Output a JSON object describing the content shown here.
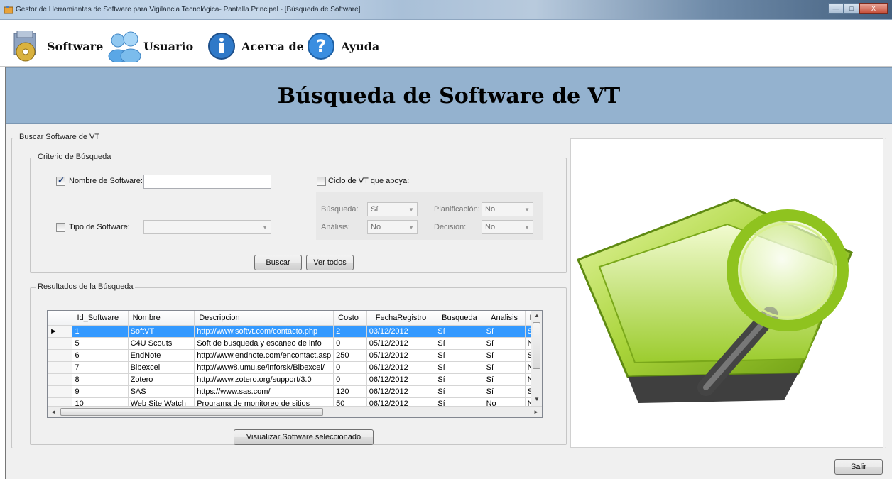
{
  "window": {
    "title": "Gestor de Herramientas de Software para Vigilancia Tecnológica- Pantalla Principal - [Búsqueda de Software]",
    "minimize_label": "—",
    "maximize_label": "□",
    "close_label": "X"
  },
  "menu": {
    "items": [
      {
        "label": "Software",
        "icon": "software-disc-icon"
      },
      {
        "label": "Usuario",
        "icon": "users-icon"
      },
      {
        "label": "Acerca de",
        "icon": "info-icon"
      },
      {
        "label": "Ayuda",
        "icon": "help-icon"
      }
    ]
  },
  "header": {
    "title": "Búsqueda de Software de VT"
  },
  "search_group": {
    "title": "Buscar Software de VT",
    "criteria": {
      "title": "Criterio de Búsqueda",
      "name_label": "Nombre de Software:",
      "name_checked": true,
      "name_value": "",
      "type_label": "Tipo de Software:",
      "type_checked": false,
      "type_value": "",
      "cycle_label": "Ciclo de VT que apoya:",
      "cycle_checked": false,
      "busqueda_label": "Búsqueda:",
      "busqueda_value": "Sí",
      "planificacion_label": "Planificación:",
      "planificacion_value": "No",
      "analisis_label": "Análisis:",
      "analisis_value": "No",
      "decision_label": "Decisión:",
      "decision_value": "No",
      "search_button": "Buscar",
      "show_all_button": "Ver todos"
    },
    "results": {
      "title": "Resultados de la Búsqueda",
      "columns": [
        "Id_Software",
        "Nombre",
        "Descripcion",
        "Costo",
        "FechaRegistro",
        "Busqueda",
        "Analisis",
        "P"
      ],
      "rows": [
        {
          "id": "1",
          "nombre": "SoftVT",
          "descripcion": "http://www.softvt.com/contacto.php",
          "costo": "2",
          "fecha": "03/12/2012",
          "busqueda": "Sí",
          "analisis": "Sí",
          "p": "Sí",
          "selected": true
        },
        {
          "id": "5",
          "nombre": "C4U Scouts",
          "descripcion": "Soft de busqueda y escaneo de info",
          "costo": "0",
          "fecha": "05/12/2012",
          "busqueda": "Sí",
          "analisis": "Sí",
          "p": "No",
          "selected": false
        },
        {
          "id": "6",
          "nombre": "EndNote",
          "descripcion": "http://www.endnote.com/encontact.asp",
          "costo": "250",
          "fecha": "05/12/2012",
          "busqueda": "Sí",
          "analisis": "Sí",
          "p": "Sí",
          "selected": false
        },
        {
          "id": "7",
          "nombre": "Bibexcel",
          "descripcion": "http://www8.umu.se/inforsk/Bibexcel/",
          "costo": "0",
          "fecha": "06/12/2012",
          "busqueda": "Sí",
          "analisis": "Sí",
          "p": "No",
          "selected": false
        },
        {
          "id": "8",
          "nombre": "Zotero",
          "descripcion": "http://www.zotero.org/support/3.0",
          "costo": "0",
          "fecha": "06/12/2012",
          "busqueda": "Sí",
          "analisis": "Sí",
          "p": "No",
          "selected": false
        },
        {
          "id": "9",
          "nombre": "SAS",
          "descripcion": "https://www.sas.com/",
          "costo": "120",
          "fecha": "06/12/2012",
          "busqueda": "Sí",
          "analisis": "Sí",
          "p": "Sí",
          "selected": false
        },
        {
          "id": "10",
          "nombre": "Web Site Watch",
          "descripcion": "Programa de monitoreo de sitios",
          "costo": "50",
          "fecha": "06/12/2012",
          "busqueda": "Sí",
          "analisis": "No",
          "p": "No",
          "selected": false
        }
      ],
      "view_button": "Visualizar Software seleccionado"
    }
  },
  "exit_button": "Salir",
  "colors": {
    "header_band": "#94b2cf",
    "selection": "#3399ff"
  }
}
